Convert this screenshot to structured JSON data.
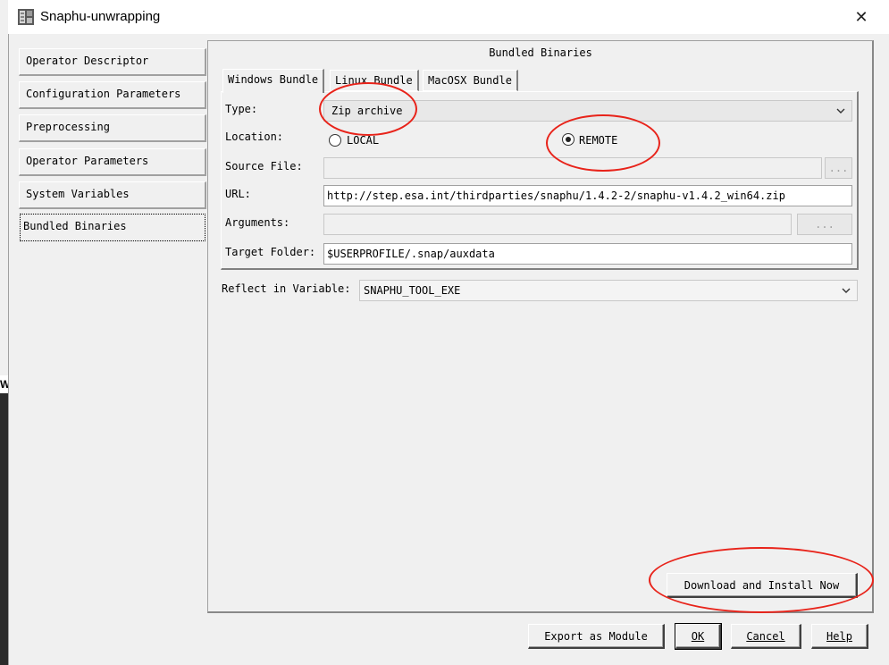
{
  "window": {
    "title": "Snaphu-unwrapping",
    "close_glyph": "✕"
  },
  "background": {
    "strip_text": "W"
  },
  "nav": {
    "items": [
      {
        "label": "Operator Descriptor"
      },
      {
        "label": "Configuration Parameters"
      },
      {
        "label": "Preprocessing"
      },
      {
        "label": "Operator Parameters"
      },
      {
        "label": "System Variables"
      },
      {
        "label": "Bundled Binaries",
        "selected": true
      }
    ]
  },
  "panel": {
    "title": "Bundled Binaries",
    "tabs": [
      {
        "label": "Windows Bundle",
        "active": true
      },
      {
        "label": "Linux Bundle"
      },
      {
        "label": "MacOSX Bundle"
      }
    ],
    "type_label": "Type:",
    "type_value": "Zip archive",
    "location_label": "Location:",
    "location_local": "LOCAL",
    "location_remote": "REMOTE",
    "location_selected": "REMOTE",
    "source_file_label": "Source File:",
    "source_file_value": "",
    "source_browse": "...",
    "url_label": "URL:",
    "url_value": "http://step.esa.int/thirdparties/snaphu/1.4.2-2/snaphu-v1.4.2_win64.zip",
    "arguments_label": "Arguments:",
    "arguments_value": "",
    "arguments_browse": "...",
    "target_folder_label": "Target Folder:",
    "target_folder_value": "$USERPROFILE/.snap/auxdata",
    "reflect_label": "Reflect in Variable:",
    "reflect_value": "SNAPHU_TOOL_EXE",
    "download_button": "Download and Install Now"
  },
  "footer": {
    "export_button": "Export as Module",
    "ok_button": "OK",
    "cancel_button": "Cancel",
    "help_button": "Help"
  },
  "colors": {
    "annotation": "#e8231a",
    "window_bg": "#f0f0f0"
  },
  "icons": {
    "app": "snap-app-icon",
    "close": "close-icon",
    "dropdown": "chevron-down-icon"
  }
}
